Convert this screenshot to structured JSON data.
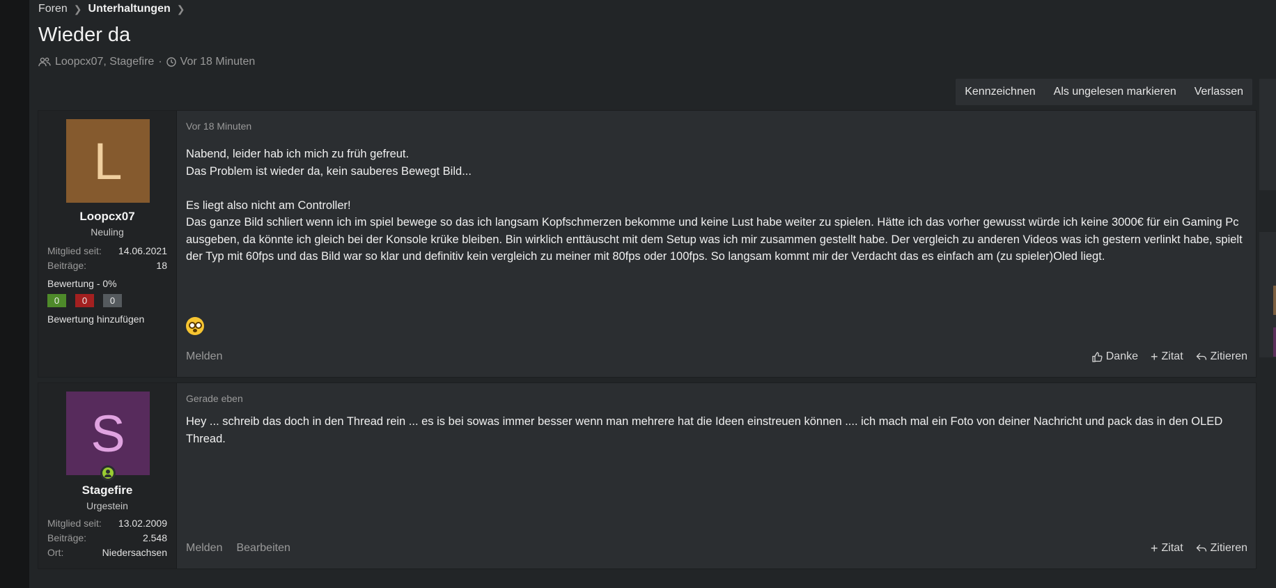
{
  "breadcrumb": {
    "root": "Foren",
    "current": "Unterhaltungen"
  },
  "page_title": "Wieder da",
  "meta": {
    "participants": "Loopcx07, Stagefire",
    "separator": "·",
    "time": "Vor 18 Minuten"
  },
  "actions": [
    "Kennzeichnen",
    "Als ungelesen markieren",
    "Verlassen"
  ],
  "posts": [
    {
      "avatar_letter": "L",
      "username": "Loopcx07",
      "user_title": "Neuling",
      "member_since_label": "Mitglied seit:",
      "member_since": "14.06.2021",
      "posts_label": "Beiträge:",
      "posts_count": "18",
      "rating_label": "Bewertung - 0%",
      "ratings": [
        "0",
        "0",
        "0"
      ],
      "add_rating": "Bewertung hinzufügen",
      "time": "Vor 18 Minuten",
      "paragraphs": [
        "Nabend, leider hab ich mich zu früh gefreut.",
        "Das Problem ist wieder da, kein sauberes Bewegt Bild...",
        "",
        "Es liegt also nicht am Controller!",
        "Das ganze Bild schliert wenn ich im spiel bewege so das ich langsam Kopfschmerzen bekomme und keine Lust habe weiter zu spielen. Hätte ich das vorher gewusst würde ich keine 3000€ für ein Gaming Pc ausgeben, da könnte ich gleich bei der Konsole krüke bleiben. Bin wirklich enttäuscht mit dem Setup was ich mir zusammen gestellt habe. Der vergleich zu anderen Videos was ich gestern verlinkt habe, spielt der Typ mit 60fps und das Bild war so klar und definitiv kein vergleich zu meiner mit 80fps oder 100fps. So langsam kommt mir der Verdacht das es einfach am (zu spieler)Oled liegt."
      ],
      "report": "Melden",
      "like": "Danke",
      "quote": "Zitat",
      "reply": "Zitieren"
    },
    {
      "avatar_letter": "S",
      "username": "Stagefire",
      "user_title": "Urgestein",
      "member_since_label": "Mitglied seit:",
      "member_since": "13.02.2009",
      "posts_label": "Beiträge:",
      "posts_count": "2.548",
      "location_label": "Ort:",
      "location": "Niedersachsen",
      "time": "Gerade eben",
      "paragraphs": [
        "Hey ... schreib das doch in den Thread rein ... es is bei sowas immer besser wenn man mehrere hat die Ideen einstreuen können .... ich mach mal ein Foto von deiner Nachricht und pack das in den OLED Thread."
      ],
      "report": "Melden",
      "edit": "Bearbeiten",
      "quote": "Zitat",
      "reply": "Zitieren"
    }
  ],
  "colors": {
    "avatar_l": "#855a2e",
    "avatar_s": "#572b5c",
    "rating_positive": "#4e8a2a",
    "rating_negative": "#a32020"
  },
  "icons": [
    "chevron-right-icon",
    "users-icon",
    "clock-icon",
    "online-user-icon",
    "emoji-icon",
    "thumbs-up-icon",
    "plus-icon",
    "reply-icon"
  ]
}
